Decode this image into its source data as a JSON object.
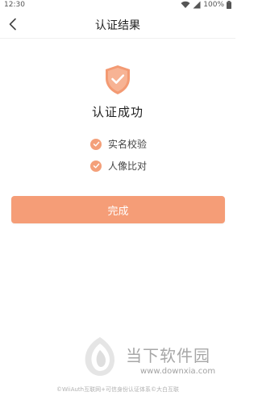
{
  "status_bar": {
    "time": "12:30",
    "battery": "100%"
  },
  "nav": {
    "title": "认证结果"
  },
  "result": {
    "title": "认证成功",
    "items": [
      {
        "label": "实名校验"
      },
      {
        "label": "人像比对"
      }
    ]
  },
  "done_button": {
    "label": "完成"
  },
  "watermark": {
    "title": "当下软件园",
    "url": "www.downxia.com"
  },
  "footer": {
    "note": "©WiiAuth互联网+可信身份认证体系©大白互联"
  },
  "colors": {
    "accent": "#f59d77",
    "check": "#f4a07a",
    "shield": "#f39a73"
  }
}
